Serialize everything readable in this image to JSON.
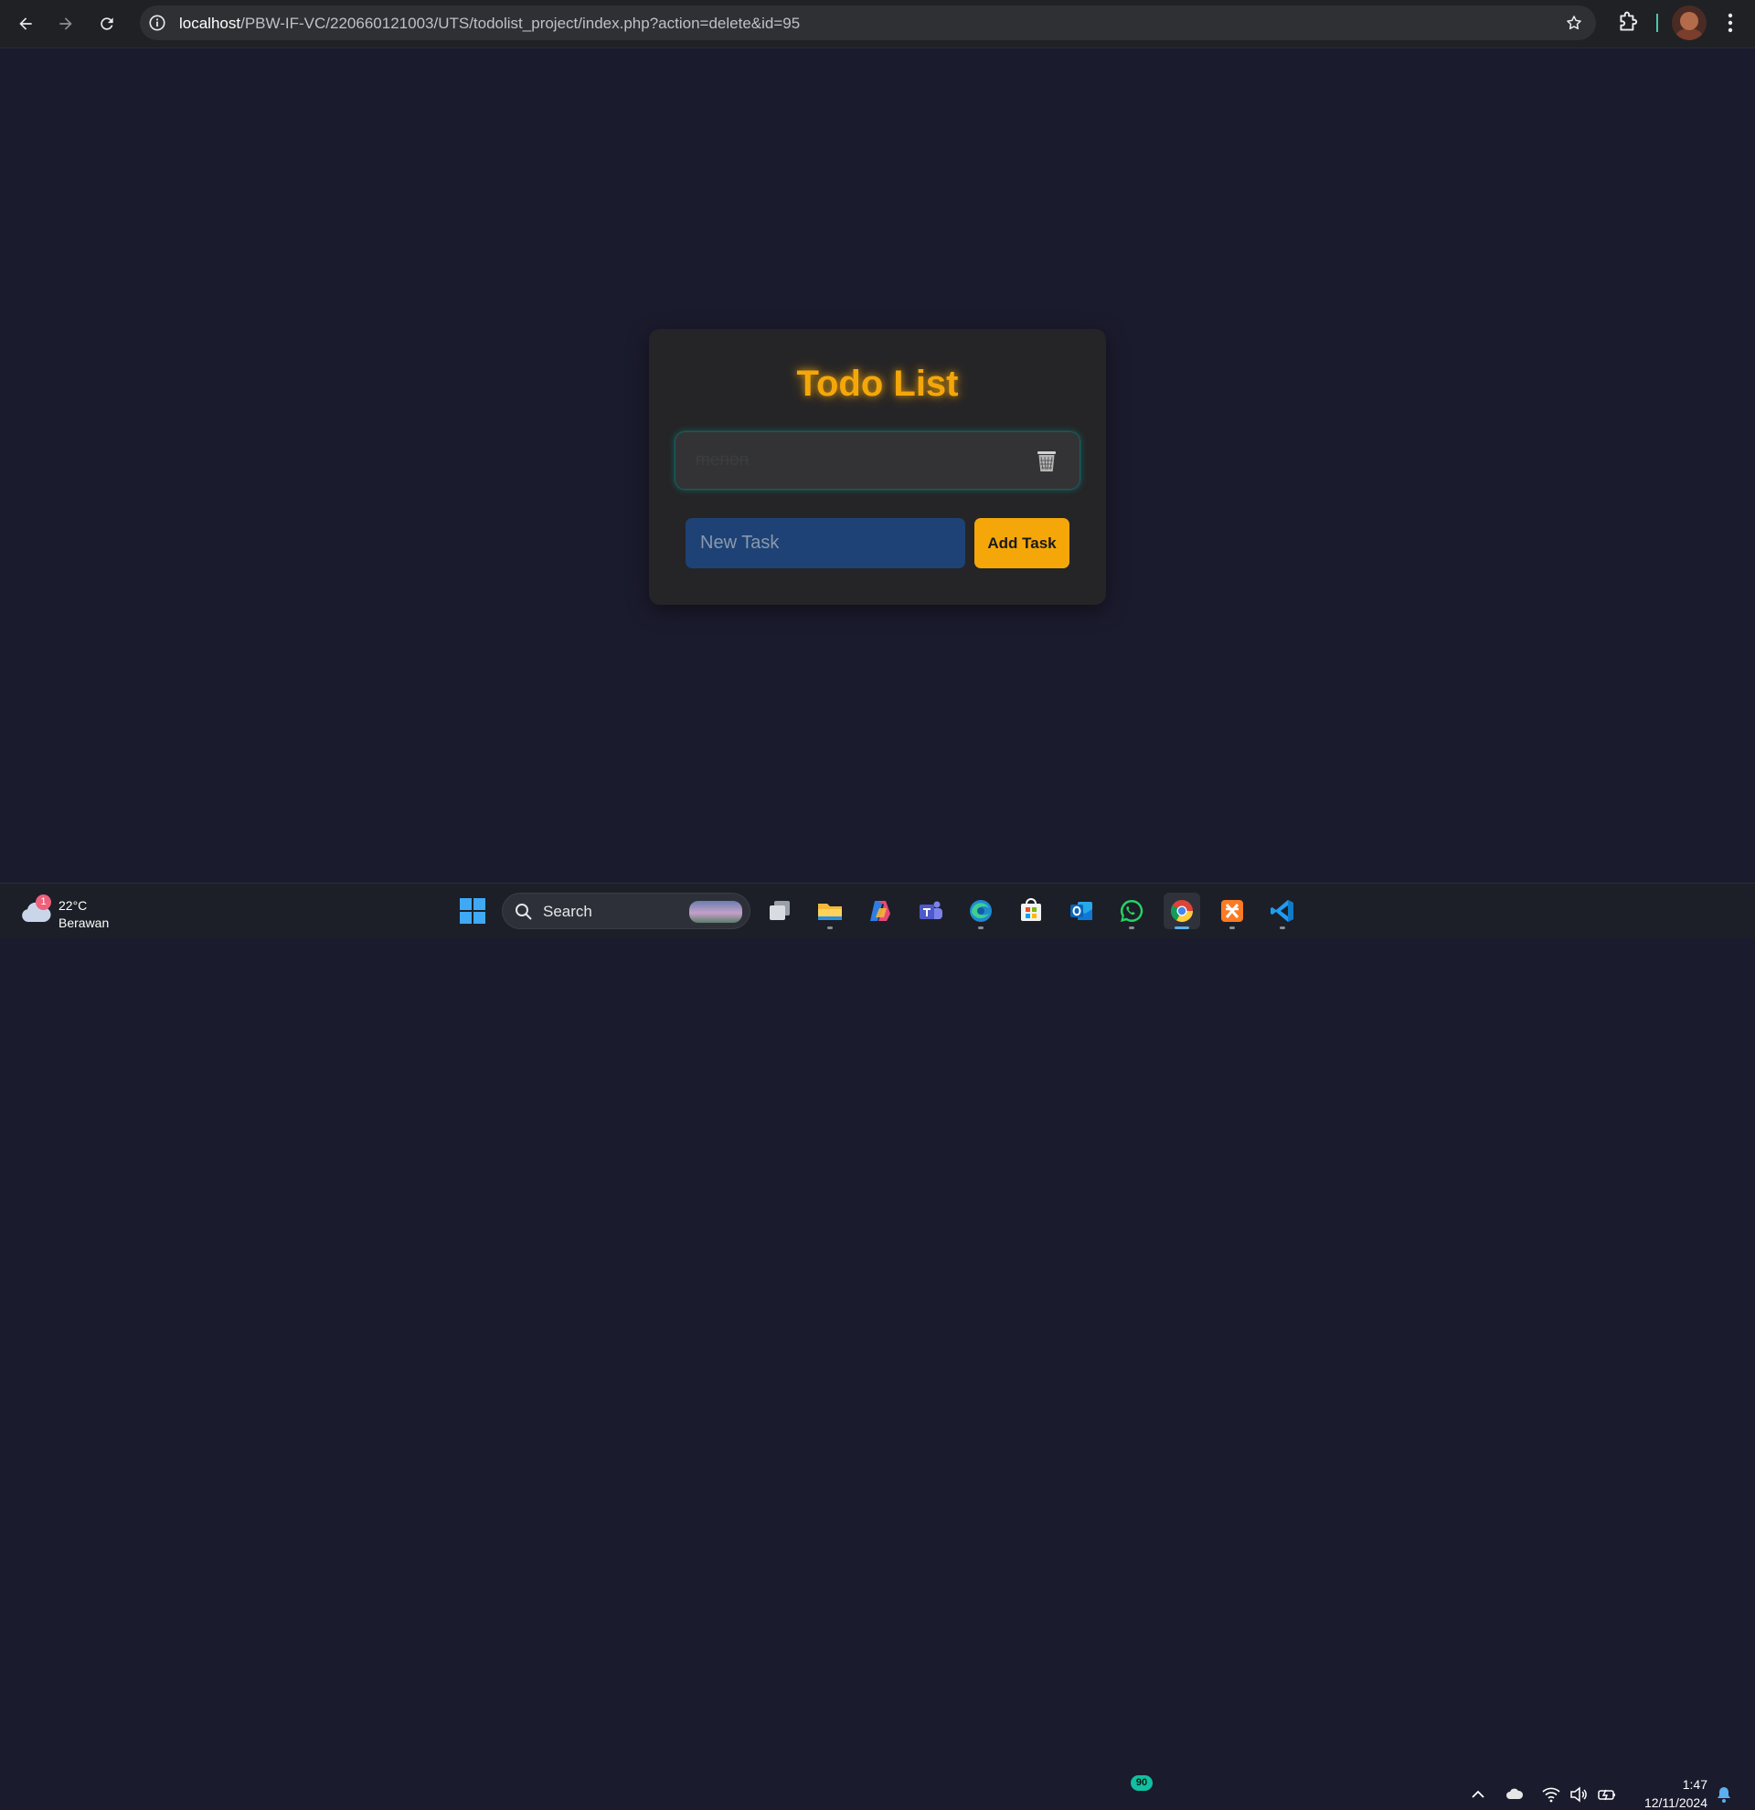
{
  "browser": {
    "url_host": "localhost",
    "url_path": "/PBW-IF-VC/220660121003/UTS/todolist_project/index.php?action=delete&id=95"
  },
  "app": {
    "title": "Todo List",
    "tasks": [
      {
        "text": "menon",
        "completed": true,
        "action_icon": "trash-icon"
      }
    ],
    "new_task_placeholder": "New Task",
    "new_task_value": "",
    "add_button_label": "Add Task",
    "accent_color": "#f5a70a",
    "input_color": "#1e4275"
  },
  "taskbar": {
    "weather": {
      "badge": "1",
      "temp": "22°C",
      "condition": "Berawan"
    },
    "search_label": "Search",
    "apps": [
      "task-view",
      "file-explorer",
      "copilot",
      "teams",
      "edge",
      "store",
      "outlook",
      "whatsapp",
      "chrome",
      "xampp",
      "vscode"
    ],
    "whatsapp_badge": "90",
    "clock": {
      "time": "1:47",
      "date": "12/11/2024"
    }
  }
}
